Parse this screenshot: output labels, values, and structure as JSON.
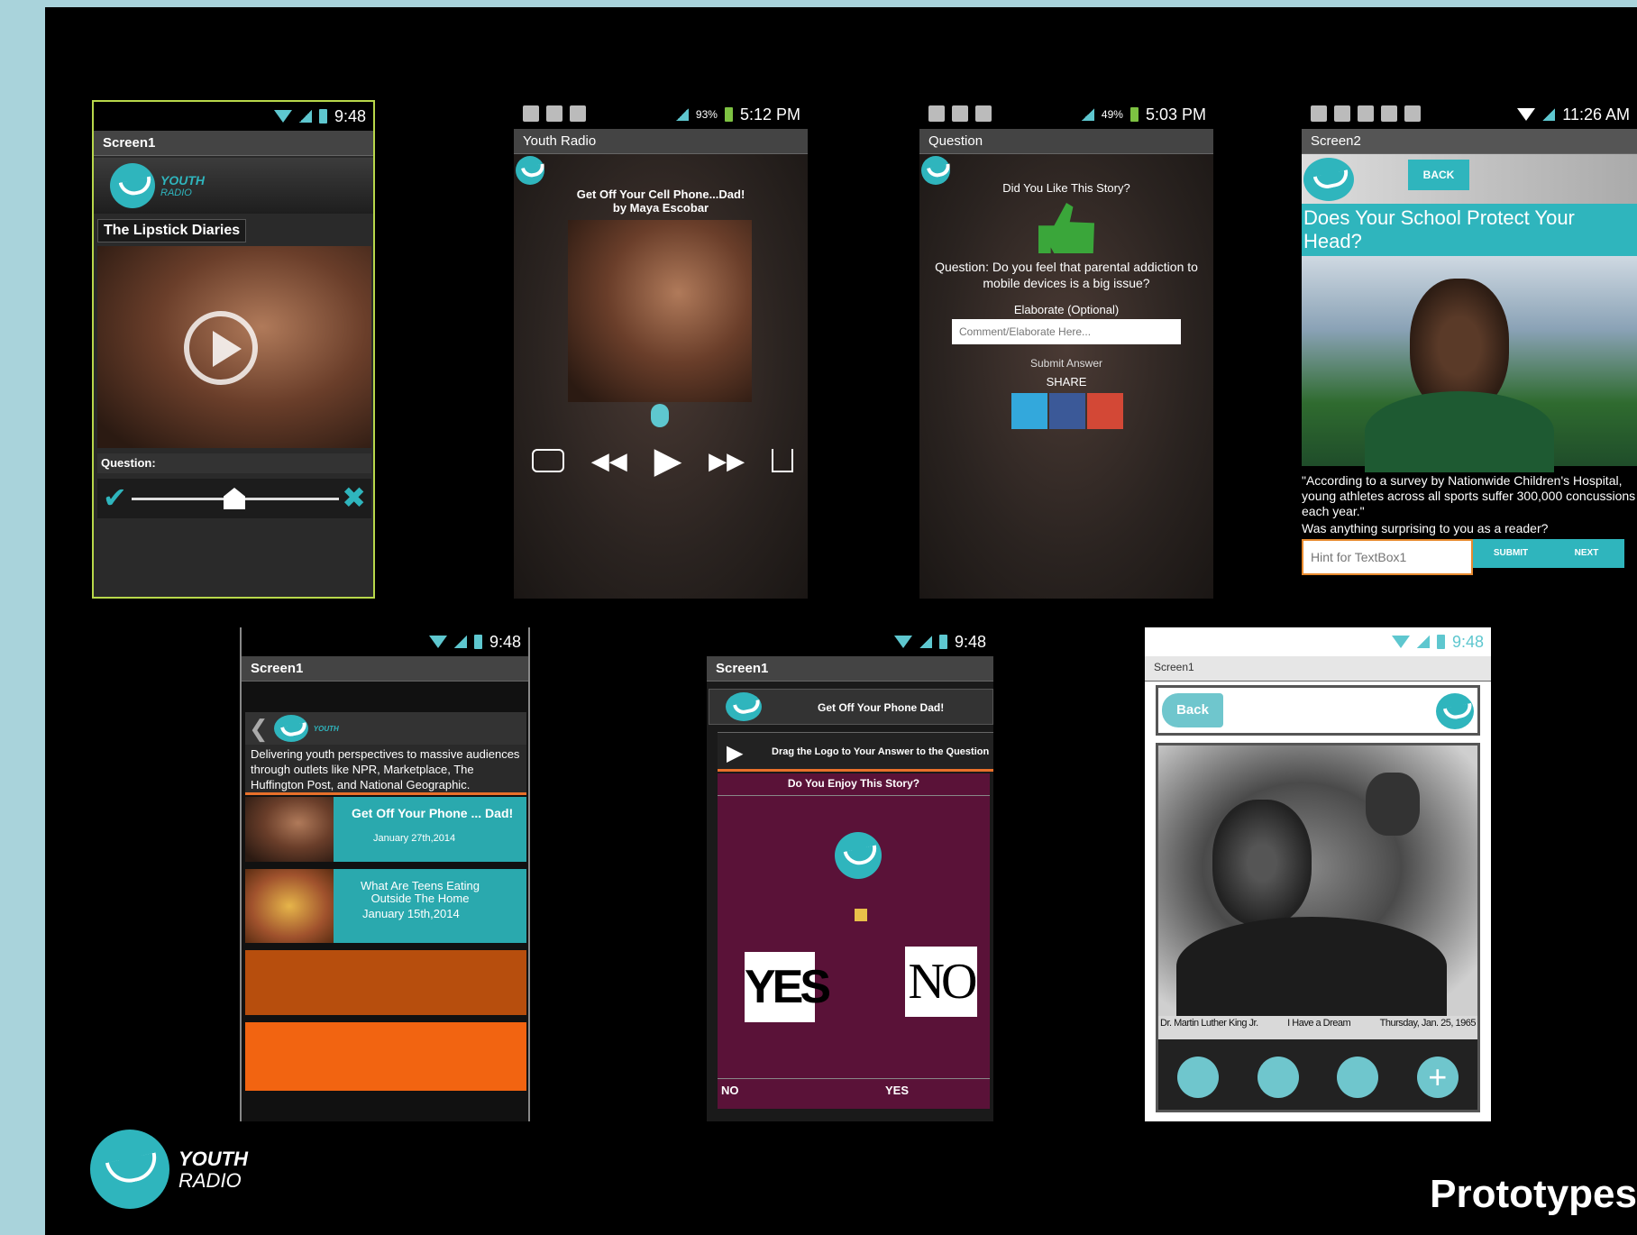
{
  "brand": {
    "line1": "YOUTH",
    "line2": "RADIO",
    "accent": "#2fb5bd"
  },
  "slide_title": "Prototypes",
  "status_time_948": "9:48",
  "screen1_label": "Screen1",
  "p1": {
    "story": "The Lipstick Diaries",
    "question_label": "Question:"
  },
  "p2": {
    "time": "5:12 PM",
    "battery": "93%",
    "title": "Youth Radio",
    "headline": "Get Off Your Cell Phone...Dad!",
    "byline": "by Maya Escobar"
  },
  "p3": {
    "time": "5:03 PM",
    "battery": "49%",
    "title": "Question",
    "q1": "Did You Like This Story?",
    "q2": "Question: Do you feel that parental addiction to mobile devices is a big issue?",
    "elaborate": "Elaborate (Optional)",
    "placeholder": "Comment/Elaborate Here...",
    "submit": "Submit Answer",
    "share": "SHARE"
  },
  "p4": {
    "time": "11:26 AM",
    "title": "Screen2",
    "back": "BACK",
    "headline": "Does Your School Protect Your Head?",
    "quote": "\"According to a survey by Nationwide Children's Hospital, young athletes across all sports suffer 300,000 concussions each year.\"",
    "prompt": "Was anything surprising to you as a reader?",
    "hint": "Hint for TextBox1",
    "submit": "SUBMIT",
    "next": "NEXT"
  },
  "p5": {
    "blurb": "Delivering youth perspectives to massive audiences through outlets like NPR, Marketplace, The Huffington Post, and National Geographic.",
    "items": [
      {
        "title": "Get Off Your Phone ... Dad!",
        "date": "January 27th,2014"
      },
      {
        "title": "What Are Teens Eating Outside The Home",
        "date": "January 15th,2014"
      }
    ]
  },
  "p6": {
    "header": "Get Off Your Phone Dad!",
    "drag": "Drag the Logo to Your Answer to the Question",
    "question": "Do You Enjoy This Story?",
    "yes_big": "YES",
    "no_big": "NO",
    "no_small": "NO",
    "yes_small": "YES"
  },
  "p7": {
    "title": "Screen1",
    "back": "Back",
    "caption_name": "Dr. Martin Luther King Jr.",
    "caption_title": "I Have a Dream",
    "caption_date": "Thursday, Jan. 25, 1965"
  }
}
